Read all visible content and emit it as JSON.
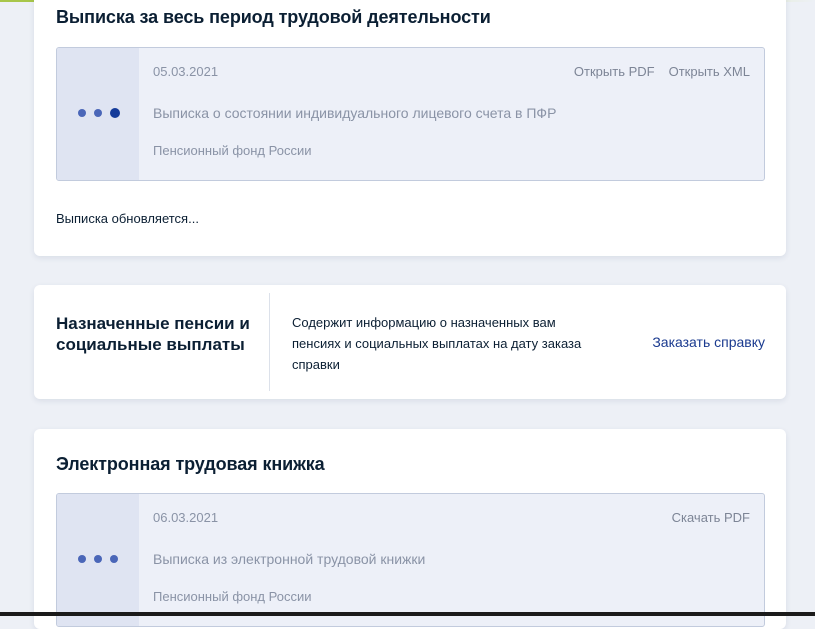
{
  "extract_card": {
    "title": "Выписка за весь период трудовой деятельности",
    "document": {
      "date": "05.03.2021",
      "name": "Выписка о состоянии индивидуального лицевого счета в ПФР",
      "org": "Пенсионный фонд России",
      "open_pdf": "Открыть PDF",
      "open_xml": "Открыть XML"
    },
    "status": "Выписка обновляется..."
  },
  "pensions_card": {
    "title": "Назначенные пенсии и социальные выплаты",
    "description": "Содержит информацию о назначенных вам пенсиях и социальных выплатах на дату заказа справки",
    "order_link": "Заказать справку"
  },
  "workbook_card": {
    "title": "Электронная трудовая книжка",
    "document": {
      "date": "06.03.2021",
      "name": "Выписка из электронной трудовой книжки",
      "org": "Пенсионный фонд России",
      "download_pdf": "Скачать PDF"
    }
  },
  "colors": {
    "accent_link": "#1a3a8f",
    "dot_active": "#153b9a",
    "dot": "#4a66b8",
    "doc_bg": "#edf0f8"
  },
  "icons": {
    "loading_dots": "loading-dots-icon"
  }
}
